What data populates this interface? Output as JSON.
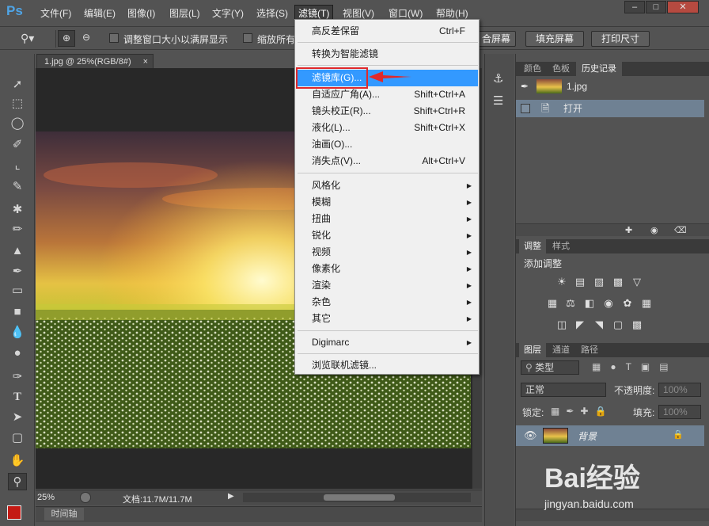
{
  "app": {
    "logo": "Ps"
  },
  "menubar": {
    "items": [
      "文件(F)",
      "编辑(E)",
      "图像(I)",
      "图层(L)",
      "文字(Y)",
      "选择(S)",
      "滤镜(T)",
      "视图(V)",
      "窗口(W)",
      "帮助(H)"
    ],
    "active": "滤镜(T)",
    "window_controls": [
      "–",
      "□",
      "✕"
    ]
  },
  "options_bar": {
    "resize_checkbox_label": "调整窗口大小以满屏显示",
    "zoom_all_label": "缩放所有",
    "fill_screen_hidden": "合屏幕",
    "fill_screen": "填充屏幕",
    "print_size": "打印尺寸"
  },
  "document": {
    "tab_title": "1.jpg @ 25%(RGB/8#)",
    "zoom": "25%",
    "doc_info": "文档:11.7M/11.7M",
    "timeline_tab": "时间轴"
  },
  "filter_menu": {
    "items": [
      {
        "label": "高反差保留",
        "shortcut": "Ctrl+F"
      },
      {
        "label": "转换为智能滤镜",
        "shortcut": ""
      },
      {
        "label": "滤镜库(G)...",
        "shortcut": "",
        "highlighted": true
      },
      {
        "label": "自适应广角(A)...",
        "shortcut": "Shift+Ctrl+A"
      },
      {
        "label": "镜头校正(R)...",
        "shortcut": "Shift+Ctrl+R"
      },
      {
        "label": "液化(L)...",
        "shortcut": "Shift+Ctrl+X"
      },
      {
        "label": "油画(O)...",
        "shortcut": ""
      },
      {
        "label": "消失点(V)...",
        "shortcut": "Alt+Ctrl+V"
      },
      {
        "label": "风格化",
        "submenu": true
      },
      {
        "label": "模糊",
        "submenu": true
      },
      {
        "label": "扭曲",
        "submenu": true
      },
      {
        "label": "锐化",
        "submenu": true
      },
      {
        "label": "视频",
        "submenu": true
      },
      {
        "label": "像素化",
        "submenu": true
      },
      {
        "label": "渲染",
        "submenu": true
      },
      {
        "label": "杂色",
        "submenu": true
      },
      {
        "label": "其它",
        "submenu": true
      },
      {
        "label": "Digimarc",
        "submenu": true
      },
      {
        "label": "浏览联机滤镜...",
        "shortcut": ""
      }
    ]
  },
  "history_panel": {
    "tabs": [
      "颜色",
      "色板",
      "历史记录"
    ],
    "active_tab": "历史记录",
    "snapshot_name": "1.jpg",
    "states": [
      "打开"
    ]
  },
  "adjustments_panel": {
    "tabs": [
      "调整",
      "样式"
    ],
    "active_tab": "调整",
    "heading": "添加调整"
  },
  "layers_panel": {
    "tabs": [
      "图层",
      "通道",
      "路径"
    ],
    "active_tab": "图层",
    "filter_kind": "类型",
    "blend_mode": "正常",
    "opacity_label": "不透明度:",
    "opacity_value": "100%",
    "lock_label": "锁定:",
    "fill_label": "填充:",
    "fill_value": "100%",
    "layer_name": "背景"
  },
  "watermark": {
    "brand": "Bai经验",
    "url": "jingyan.baidu.com"
  },
  "colors": {
    "highlight": "#3399ff",
    "annotation_red": "#e0292b",
    "foreground_swatch": "#c41a14"
  }
}
